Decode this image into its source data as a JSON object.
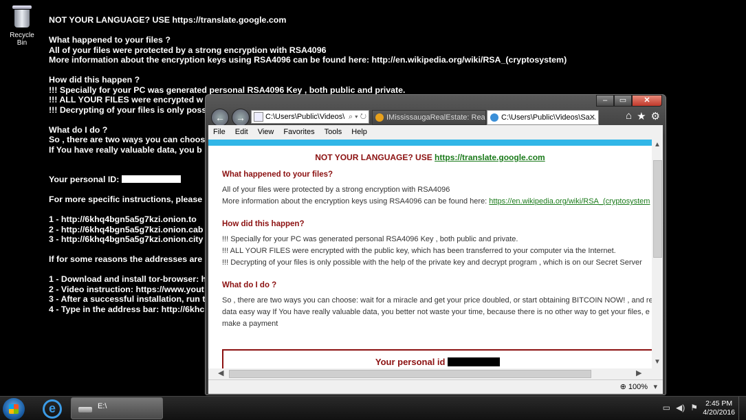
{
  "desktop": {
    "recycle_label": "Recycle Bin",
    "note_lines": [
      "NOT YOUR LANGUAGE? USE https://translate.google.com",
      "",
      "What happened to your files ?",
      "All of your files were protected by a strong encryption with RSA4096",
      "More information about the encryption keys using RSA4096 can be found here: http://en.wikipedia.org/wiki/RSA_(cryptosystem)",
      "",
      "How did this happen ?",
      "!!! Specially for your PC was generated personal RSA4096 Key , both public and private.",
      "!!! ALL YOUR FILES were encrypted w",
      "!!! Decrypting of your files is only poss",
      "",
      "What do I do ?",
      "So , there are two ways you can choos",
      "If You have really valuable data, you b",
      "",
      "",
      "Your personal ID:",
      "",
      "For more specific instructions, please",
      "",
      "1 - http://6khq4bgn5a5g7kzi.onion.to",
      "2 - http://6khq4bgn5a5g7kzi.onion.cab",
      "3 - http://6khq4bgn5a5g7kzi.onion.city",
      "",
      "If for some reasons the addresses are",
      "",
      "1 - Download and install tor-browser: h",
      "2 - Video instruction: https://www.yout",
      "3 - After a successful installation, run t",
      "4 - Type in the address bar: http://6khc"
    ]
  },
  "browser": {
    "controls": {
      "min": "–",
      "max": "▭",
      "close": "✕"
    },
    "address": "C:\\Users\\Public\\Videos\\",
    "address_tools": "⌕ ▾ ↻",
    "tabs": [
      {
        "label": "IMississaugaRealEstate: Real E..."
      },
      {
        "label": "C:\\Users\\Public\\Videos\\Sa...",
        "close": "✕"
      }
    ],
    "right_icons": {
      "home": "⌂",
      "favorites": "★",
      "tools": "⚙"
    },
    "menu": [
      "File",
      "Edit",
      "View",
      "Favorites",
      "Tools",
      "Help"
    ],
    "zoom": "100%",
    "page": {
      "title_prefix": "NOT YOUR LANGUAGE? USE ",
      "title_link": "https://translate.google.com",
      "h1": "What happened to your files?",
      "p1a": "All of your files were protected by a strong encryption with RSA4096",
      "p1b": "More information about the encryption keys using RSA4096 can be found here: ",
      "p1b_link": "https://en.wikipedia.org/wiki/RSA_(cryptosystem",
      "h2": "How did this happen?",
      "p2a": "!!! Specially for your PC was generated personal RSA4096 Key , both public and private.",
      "p2b": "!!! ALL YOUR FILES were encrypted with the public key, which has been transferred to your computer via the Internet.",
      "p2c": "!!! Decrypting of your files is only possible with the help of the private key and decrypt program , which is on our Secret Server",
      "h3": "What do I do ?",
      "p3a": "So , there are two ways you can choose: wait for a miracle and get your price doubled, or start obtaining BITCOIN NOW! , and re",
      "p3b": "data easy way If You have really valuable data, you better not waste your time, because there is no other way to get your files, e",
      "p3c": "make a payment",
      "id_label": "Your personal id"
    }
  },
  "taskbar": {
    "explorer_label": "E:\\",
    "time": "2:45 PM",
    "date": "4/20/2016"
  }
}
